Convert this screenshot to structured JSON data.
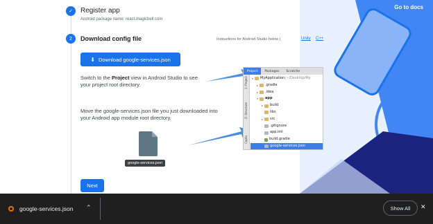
{
  "header": {
    "go_to_docs": "Go to docs"
  },
  "steps": {
    "register": {
      "title": "Register app",
      "subtitle": "Android package name: react.magicbell.com"
    },
    "config": {
      "number": "2",
      "title": "Download config file",
      "instructions_label": "Instructions for Android Studio below",
      "separator": "|",
      "link_unity": "Unity",
      "link_cpp": "C++",
      "download_button": "Download google-services.json",
      "switch_text_pre": "Switch to the ",
      "switch_text_bold": "Project",
      "switch_text_post": " view in Android Studio to see your project root directory.",
      "move_text": "Move the google-services.json file you just downloaded into your Android app module root directory.",
      "file_label": "google-services.json",
      "next_button": "Next"
    }
  },
  "android_studio": {
    "tabs": [
      "Project",
      "Packages",
      "Scratche"
    ],
    "side_labels": [
      "1: Project",
      "Z: Structure",
      "Captu"
    ],
    "tree": [
      {
        "indent": 0,
        "twisty": "▾",
        "icon": "fold",
        "label": "MyApplication",
        "suffix": " (~/Desktop/My"
      },
      {
        "indent": 1,
        "twisty": "▸",
        "icon": "fold",
        "label": ".gradle"
      },
      {
        "indent": 1,
        "twisty": "▸",
        "icon": "fold",
        "label": ".idea"
      },
      {
        "indent": 1,
        "twisty": "▾",
        "icon": "fold",
        "label": "app",
        "bold": true
      },
      {
        "indent": 2,
        "twisty": "▸",
        "icon": "fold",
        "label": "build"
      },
      {
        "indent": 2,
        "twisty": "",
        "icon": "fold",
        "label": "libs"
      },
      {
        "indent": 2,
        "twisty": "▸",
        "icon": "fold",
        "label": "src"
      },
      {
        "indent": 2,
        "twisty": "",
        "icon": "filei",
        "label": ".gitignore"
      },
      {
        "indent": 2,
        "twisty": "",
        "icon": "filei",
        "label": "app.iml"
      },
      {
        "indent": 2,
        "twisty": "",
        "icon": "gradlei",
        "label": "build.gradle"
      },
      {
        "indent": 2,
        "twisty": "",
        "icon": "filei",
        "label": "google-services.json",
        "selected": true
      },
      {
        "indent": 2,
        "twisty": "",
        "icon": "filei",
        "label": "proguard-rules.pro"
      },
      {
        "indent": 1,
        "twisty": "▸",
        "icon": "fold",
        "label": "gradle"
      }
    ]
  },
  "download_bar": {
    "file_name": "google-services.json",
    "show_all": "Show All"
  },
  "icons": {
    "check": "✓",
    "download": "⬇",
    "chevron_up": "⌃",
    "close": "✕"
  },
  "colors": {
    "primary": "#1a73e8",
    "deco_blue": "#4285f4",
    "deco_navy": "#1a237e",
    "bar_bg": "#1f1f1f"
  }
}
